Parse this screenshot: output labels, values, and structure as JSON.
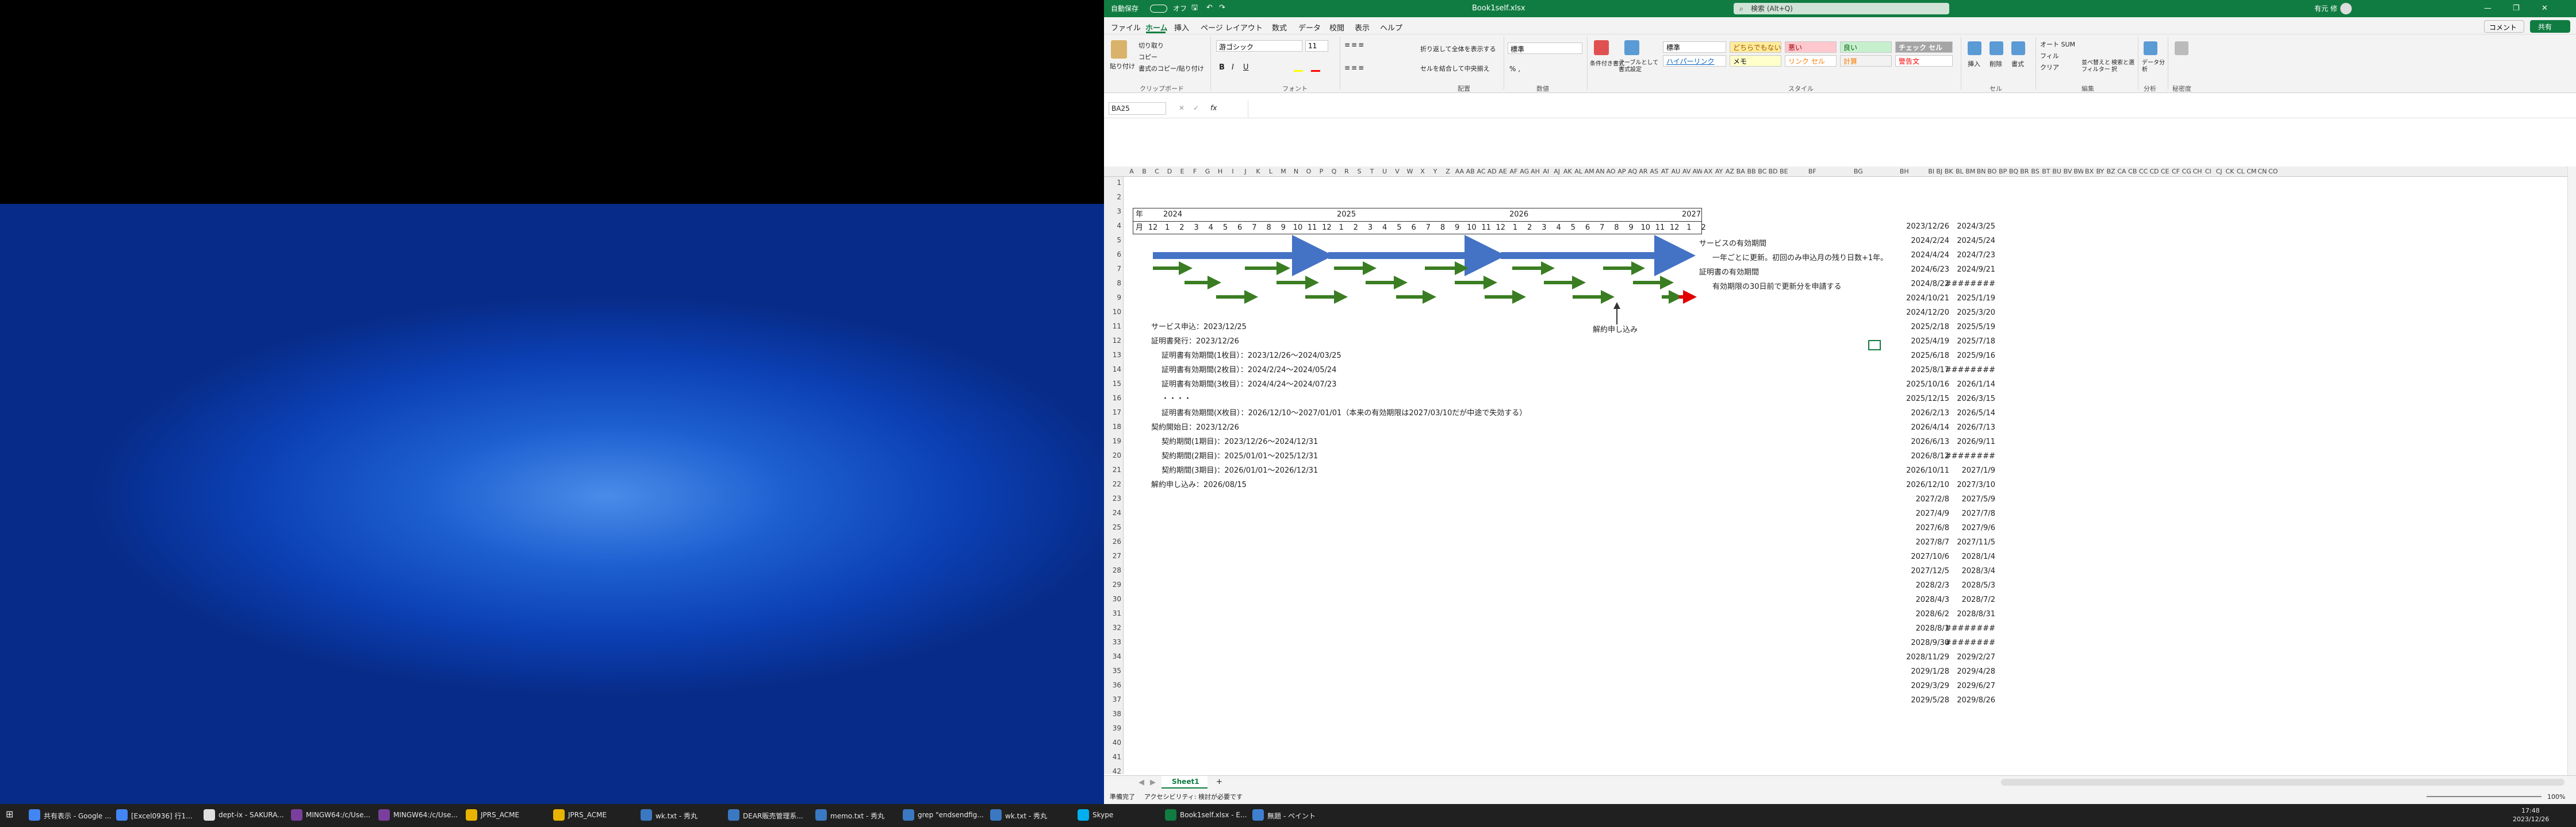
{
  "titlebar": {
    "autosave": "自動保存",
    "autosave_state": "オフ",
    "filename": "Book1self.xlsx",
    "search": "検索 (Alt+Q)",
    "user": "有元 修",
    "minimize": "—",
    "restore": "❐",
    "close": "✕"
  },
  "tabs": [
    "ファイル",
    "ホーム",
    "挿入",
    "ページ レイアウト",
    "数式",
    "データ",
    "校閲",
    "表示",
    "ヘルプ"
  ],
  "comment_btn": "コメント",
  "share_btn": "共有",
  "ribbon": {
    "clipboard": {
      "paste": "貼り付け",
      "cut": "切り取り",
      "copy": "コピー",
      "format_painter": "書式のコピー/貼り付け",
      "label": "クリップボード"
    },
    "font": {
      "name": "游ゴシック",
      "size": "11",
      "label": "フォント"
    },
    "alignment": {
      "wrap": "折り返して全体を表示する",
      "merge": "セルを結合して中央揃え",
      "label": "配置"
    },
    "number": {
      "format": "標準",
      "label": "数値"
    },
    "styles": {
      "cond": "条件付き書式",
      "table": "テーブルとして書式設定",
      "standard": "標準",
      "neutral": "どちらでもない",
      "bad": "悪い",
      "good": "良い",
      "check": "チェック セル",
      "hyperlink": "ハイパーリンク",
      "memo": "メモ",
      "link": "リンク セル",
      "calc": "計算",
      "warn": "警告文",
      "label": "スタイル"
    },
    "cells": {
      "insert": "挿入",
      "delete": "削除",
      "format": "書式",
      "label": "セル"
    },
    "editing": {
      "autosum": "オート SUM",
      "fill": "フィル",
      "clear": "クリア",
      "sort": "並べ替えとフィルター",
      "find": "検索と選択",
      "label": "編集"
    },
    "analysis": {
      "analyze": "データ分析",
      "label": "分析"
    },
    "sensitivity": {
      "label": "秘密度"
    }
  },
  "namebox": "BA25",
  "fx": "fx",
  "columns": [
    "A",
    "B",
    "C",
    "D",
    "E",
    "F",
    "G",
    "H",
    "I",
    "J",
    "K",
    "L",
    "M",
    "N",
    "O",
    "P",
    "Q",
    "R",
    "S",
    "T",
    "U",
    "V",
    "W",
    "X",
    "Y",
    "Z",
    "AA",
    "AB",
    "AC",
    "AD",
    "AE",
    "AF",
    "AG",
    "AH",
    "AI",
    "AJ",
    "AK",
    "AL",
    "AM",
    "AN",
    "AO",
    "AP",
    "AQ",
    "AR",
    "AS",
    "AT",
    "AU",
    "AV",
    "AW",
    "AX",
    "AY",
    "AZ",
    "BA",
    "BB",
    "BC",
    "BD",
    "BE",
    "BF",
    "BG",
    "BH",
    "BI",
    "BJ",
    "BK",
    "BL",
    "BM",
    "BN",
    "BO",
    "BP",
    "BQ",
    "BR",
    "BS",
    "BT",
    "BU",
    "BV",
    "BW",
    "BX",
    "BY",
    "BZ",
    "CA",
    "CB",
    "CC",
    "CD",
    "CE",
    "CF",
    "CG",
    "CH",
    "CI",
    "CJ",
    "CK",
    "CL",
    "CM",
    "CN",
    "CO"
  ],
  "rows": [
    "1",
    "2",
    "3",
    "4",
    "5",
    "6",
    "7",
    "8",
    "9",
    "10",
    "11",
    "12",
    "13",
    "14",
    "15",
    "16",
    "17",
    "18",
    "19",
    "20",
    "21",
    "22",
    "23",
    "24",
    "25",
    "26",
    "27",
    "28",
    "29",
    "30",
    "31",
    "32",
    "33",
    "34",
    "35",
    "36",
    "37",
    "38",
    "39",
    "40",
    "41",
    "42"
  ],
  "timeline": {
    "year_label": "年",
    "month_label": "月",
    "years": [
      "2024",
      "2025",
      "2026",
      "2027"
    ],
    "months": [
      "12",
      "1",
      "2",
      "3",
      "4",
      "5",
      "6",
      "7",
      "8",
      "9",
      "10",
      "11",
      "12",
      "1",
      "2",
      "3",
      "4",
      "5",
      "6",
      "7",
      "8",
      "9",
      "10",
      "11",
      "12",
      "1",
      "2",
      "3",
      "4",
      "5",
      "6",
      "7",
      "8",
      "9",
      "10",
      "11",
      "12",
      "1",
      "2"
    ]
  },
  "annotations": {
    "service": "サービスの有効期間",
    "service_note": "一年ごとに更新。初回のみ申込月の残り日数+1年。",
    "cert": "証明書の有効期間",
    "cert_note": "有効期限の30日前で更新分を申請する",
    "cancel": "解約申し込み"
  },
  "notes": [
    {
      "row": "11",
      "indent": 0,
      "text": "サービス申込：2023/12/25"
    },
    {
      "row": "12",
      "indent": 0,
      "text": "証明書発行：2023/12/26"
    },
    {
      "row": "13",
      "indent": 1,
      "text": "証明書有効期間(1枚目）：2023/12/26～2024/03/25"
    },
    {
      "row": "14",
      "indent": 1,
      "text": "証明書有効期間(2枚目）：2024/2/24～2024/05/24"
    },
    {
      "row": "15",
      "indent": 1,
      "text": "証明書有効期間(3枚目）：2024/4/24～2024/07/23"
    },
    {
      "row": "16",
      "indent": 1,
      "text": "・・・・"
    },
    {
      "row": "17",
      "indent": 1,
      "text": "証明書有効期間(X枚目）：2026/12/10～2027/01/01（本来の有効期限は2027/03/10だが中途で失効する）"
    },
    {
      "row": "18",
      "indent": 0,
      "text": "契約開始日：2023/12/26"
    },
    {
      "row": "19",
      "indent": 1,
      "text": "契約期間(1期目)：2023/12/26～2024/12/31"
    },
    {
      "row": "20",
      "indent": 1,
      "text": "契約期間(2期目)：2025/01/01～2025/12/31"
    },
    {
      "row": "21",
      "indent": 1,
      "text": "契約期間(3期目)：2026/01/01～2026/12/31"
    },
    {
      "row": "22",
      "indent": 0,
      "text": "解約申し込み：2026/08/15"
    }
  ],
  "dates": [
    [
      "2023/12/26",
      "2024/3/25"
    ],
    [
      "2024/2/24",
      "2024/5/24"
    ],
    [
      "2024/4/24",
      "2024/7/23"
    ],
    [
      "2024/6/23",
      "2024/9/21"
    ],
    [
      "2024/8/22",
      "########"
    ],
    [
      "2024/10/21",
      "2025/1/19"
    ],
    [
      "2024/12/20",
      "2025/3/20"
    ],
    [
      "2025/2/18",
      "2025/5/19"
    ],
    [
      "2025/4/19",
      "2025/7/18"
    ],
    [
      "2025/6/18",
      "2025/9/16"
    ],
    [
      "2025/8/17",
      "########"
    ],
    [
      "2025/10/16",
      "2026/1/14"
    ],
    [
      "2025/12/15",
      "2026/3/15"
    ],
    [
      "2026/2/13",
      "2026/5/14"
    ],
    [
      "2026/4/14",
      "2026/7/13"
    ],
    [
      "2026/6/13",
      "2026/9/11"
    ],
    [
      "2026/8/12",
      "########"
    ],
    [
      "2026/10/11",
      "2027/1/9"
    ],
    [
      "2026/12/10",
      "2027/3/10"
    ],
    [
      "2027/2/8",
      "2027/5/9"
    ],
    [
      "2027/4/9",
      "2027/7/8"
    ],
    [
      "2027/6/8",
      "2027/9/6"
    ],
    [
      "2027/8/7",
      "2027/11/5"
    ],
    [
      "2027/10/6",
      "2028/1/4"
    ],
    [
      "2027/12/5",
      "2028/3/4"
    ],
    [
      "2028/2/3",
      "2028/5/3"
    ],
    [
      "2028/4/3",
      "2028/7/2"
    ],
    [
      "2028/6/2",
      "2028/8/31"
    ],
    [
      "2028/8/1",
      "########"
    ],
    [
      "2028/9/30",
      "########"
    ],
    [
      "2028/11/29",
      "2029/2/27"
    ],
    [
      "2029/1/28",
      "2029/4/28"
    ],
    [
      "2029/3/29",
      "2029/6/27"
    ],
    [
      "2029/5/28",
      "2029/8/26"
    ]
  ],
  "sheet": {
    "tab": "Sheet1",
    "add": "+"
  },
  "status": {
    "ready": "準備完了",
    "accessibility": "アクセシビリティ: 検討が必要です",
    "zoom": "100%"
  },
  "taskbar": {
    "items": [
      "共有表示 - Google ...",
      "[Excel0936] 行1...",
      "dept-ix - SAKURA...",
      "MINGW64:/c/Use...",
      "MINGW64:/c/Use...",
      "JPRS_ACME",
      "JPRS_ACME",
      "wk.txt - 秀丸",
      "DEAR販売管理系...",
      "memo.txt - 秀丸",
      "grep \"endsendfig...",
      "wk.txt - 秀丸",
      "Skype",
      "Book1self.xlsx - E...",
      "無題 - ペイント"
    ],
    "time": "17:48",
    "date": "2023/12/26"
  },
  "colors": {
    "excel_green": "#107c41",
    "arrow_blue": "#4472c4",
    "arrow_green": "#3a7d22",
    "arrow_red": "#e00000"
  }
}
